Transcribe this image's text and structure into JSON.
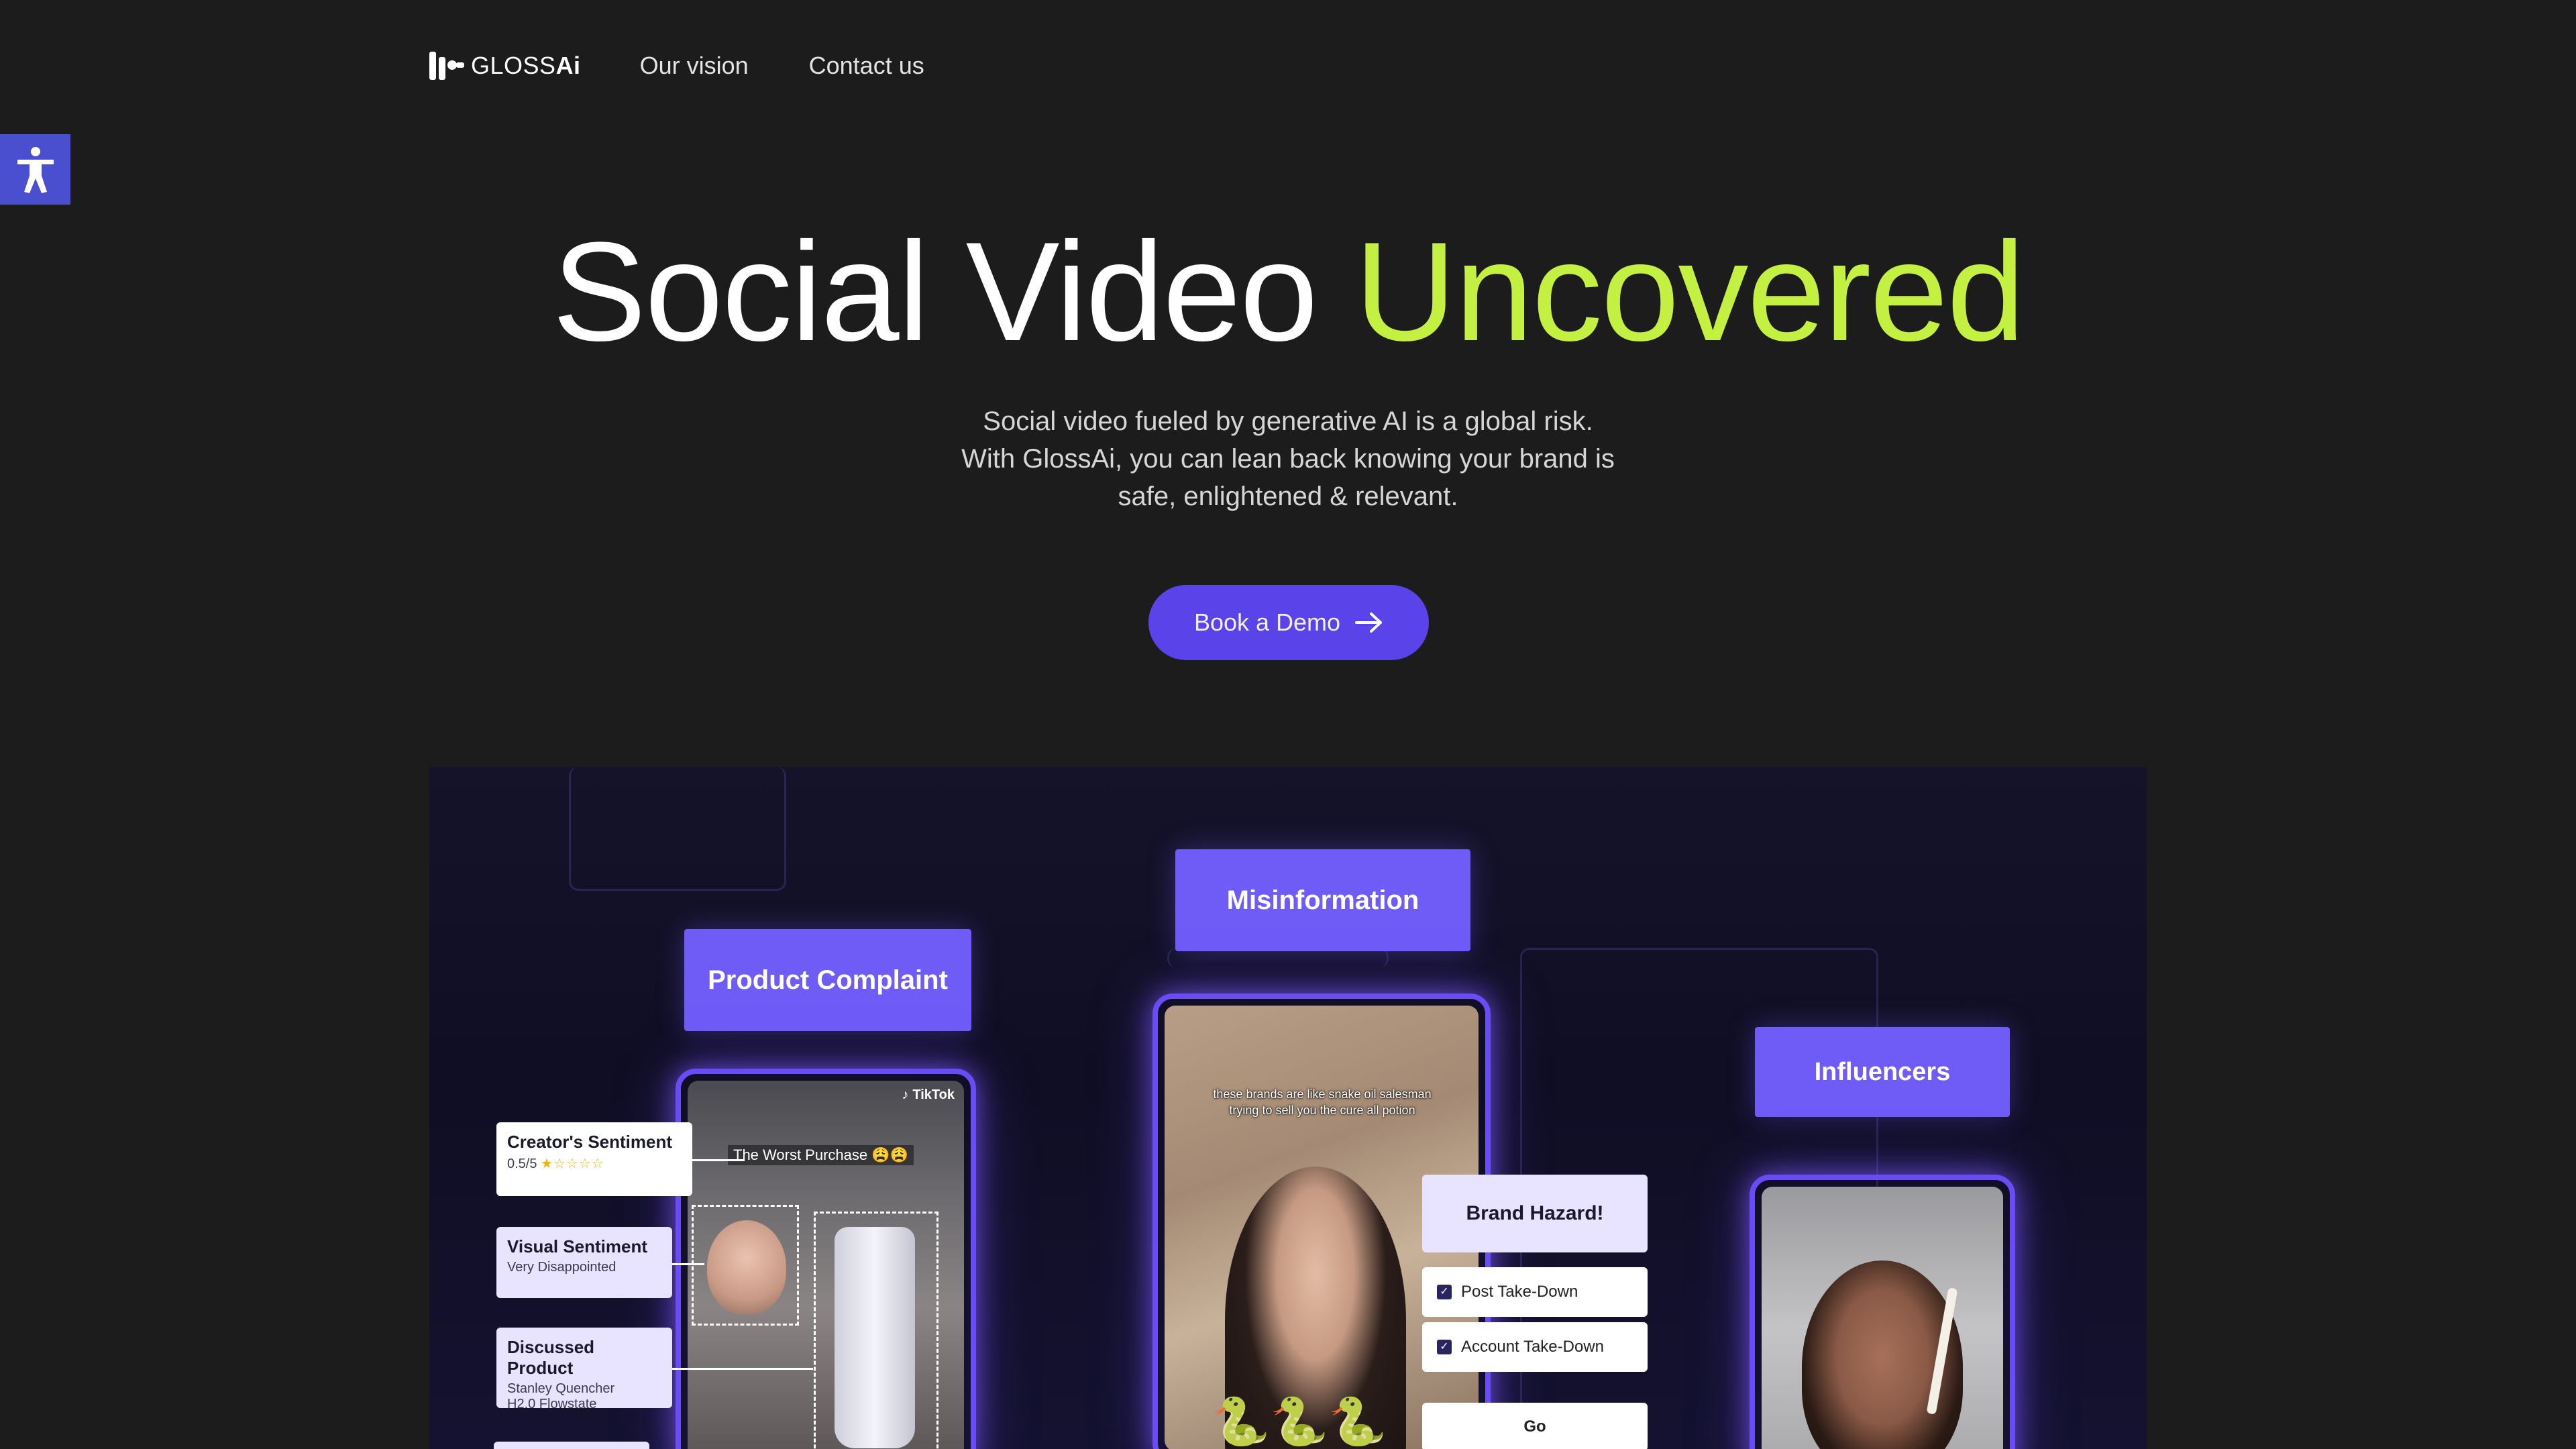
{
  "accessibility": {
    "icon": "accessibility-icon"
  },
  "nav": {
    "logo_light": "GLOSS",
    "logo_bold": "Ai",
    "links": [
      "Our vision",
      "Contact us"
    ]
  },
  "hero": {
    "title_main": "Social Video ",
    "title_accent": "Uncovered",
    "subtitle_line1": "Social video fueled by generative AI is a global risk.",
    "subtitle_line2": "With GlossAi, you can lean back knowing your brand is",
    "subtitle_line3": "safe, enlightened & relevant.",
    "cta_label": "Book a Demo"
  },
  "showcase": {
    "tags": {
      "product_complaint": "Product Complaint",
      "misinformation": "Misinformation",
      "influencers": "Influencers"
    },
    "left_phone": {
      "platform": "TikTok",
      "caption": "The Worst Purchase 😩😩"
    },
    "middle_phone": {
      "caption": "these brands are like snake oil salesman trying to sell you the cure all potion",
      "emoji": "🐍🐍🐍"
    },
    "cards": {
      "creator_sentiment_title": "Creator's Sentiment",
      "creator_sentiment_score": "0.5/5",
      "creator_sentiment_stars": "★☆☆☆☆",
      "visual_sentiment_title": "Visual Sentiment",
      "visual_sentiment_value": "Very Disappointed",
      "discussed_product_title": "Discussed Product",
      "discussed_product_line1": "Stanley Quencher",
      "discussed_product_line2": "H2.0 Flowstate"
    },
    "hazard": {
      "title": "Brand Hazard!",
      "option1": "Post Take-Down",
      "option2": "Account Take-Down",
      "go_label": "Go"
    }
  },
  "colors": {
    "accent_green": "#c4f041",
    "brand_purple": "#5a43e8",
    "tag_purple": "#6f5bf6"
  }
}
